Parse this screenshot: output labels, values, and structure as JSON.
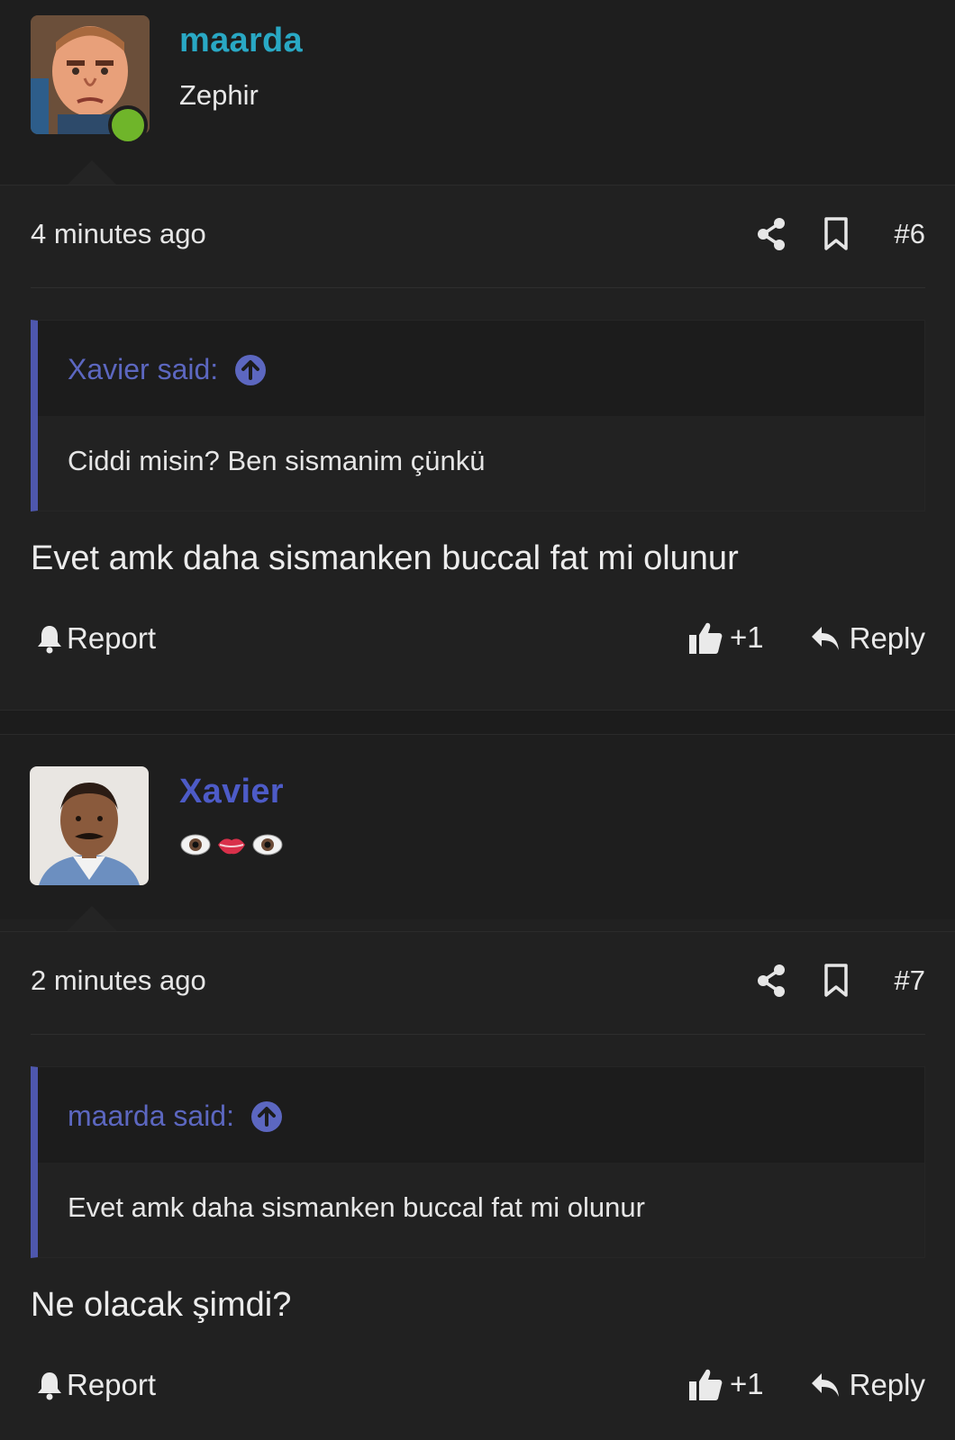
{
  "posts": [
    {
      "username": "maarda",
      "username_color": "#29a8c4",
      "user_title": "Zephir",
      "online": true,
      "timestamp": "4 minutes ago",
      "post_number": "#6",
      "quote": {
        "author_label": "Xavier said:",
        "text": "Ciddi misin? Ben sismanim çünkü"
      },
      "message": "Evet amk daha sismanken buccal fat mi olunur",
      "actions": {
        "report": "Report",
        "like": "+1",
        "reply": "Reply"
      }
    },
    {
      "username": "Xavier",
      "username_color": "#4d5bc7",
      "user_title_emoji": [
        "eye-icon",
        "lips-icon",
        "eye-icon"
      ],
      "timestamp": "2 minutes ago",
      "post_number": "#7",
      "quote": {
        "author_label": "maarda said:",
        "text": "Evet amk daha sismanken buccal fat mi olunur"
      },
      "message": "Ne olacak şimdi?",
      "actions": {
        "report": "Report",
        "like": "+1",
        "reply": "Reply"
      }
    }
  ],
  "colors": {
    "background": "#212121",
    "quote_accent": "#4e57ad",
    "quote_author": "#5c67c0",
    "online_indicator": "#6fb52a"
  }
}
